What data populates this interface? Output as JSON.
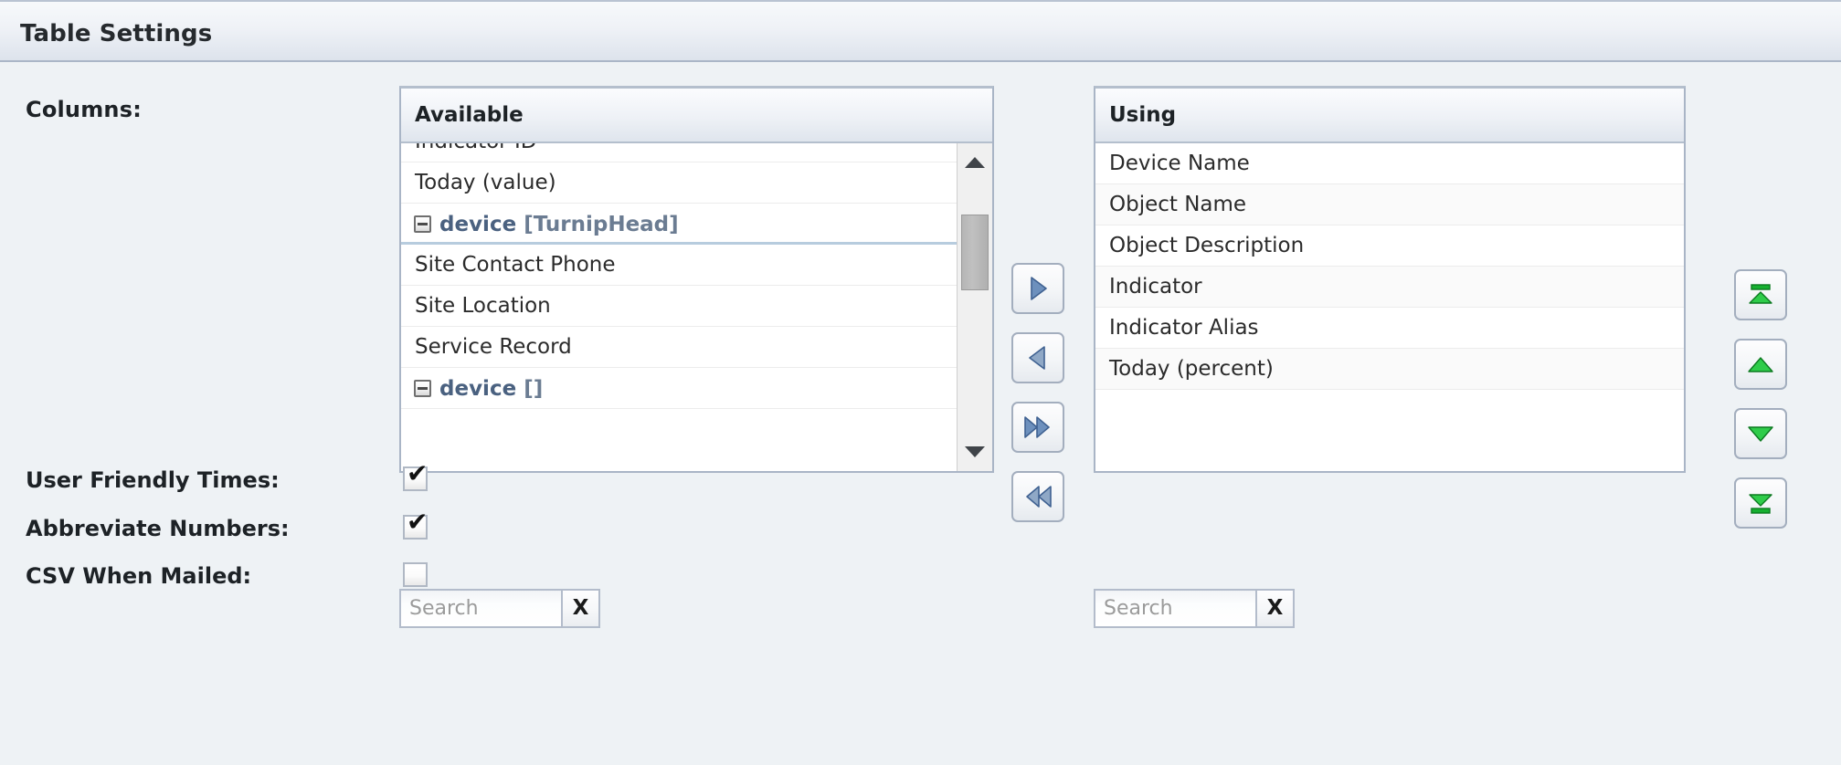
{
  "window": {
    "title": "Table Settings"
  },
  "form": {
    "columns_label": "Columns:"
  },
  "available": {
    "header": "Available",
    "rows": [
      {
        "label": "Indicator ID",
        "type": "item",
        "partial": true
      },
      {
        "label": "Today (value)",
        "type": "item"
      },
      {
        "label": "device [TurnipHead]",
        "type": "group",
        "name": "device",
        "bracket": "[TurnipHead]"
      },
      {
        "label": "Site Contact Phone",
        "type": "item"
      },
      {
        "label": "Site Location",
        "type": "item"
      },
      {
        "label": "Service Record",
        "type": "item"
      },
      {
        "label": "device []",
        "type": "group",
        "name": "device",
        "bracket": "[]"
      }
    ],
    "search": {
      "value": "",
      "placeholder": "Search",
      "clear_label": "X"
    },
    "scrollbar": {
      "up_icon": "triangle-up-icon",
      "down_icon": "triangle-down-icon"
    }
  },
  "using": {
    "header": "Using",
    "rows": [
      {
        "label": "Device Name"
      },
      {
        "label": "Object Name"
      },
      {
        "label": "Object Description"
      },
      {
        "label": "Indicator"
      },
      {
        "label": "Indicator Alias"
      },
      {
        "label": "Today (percent)"
      }
    ],
    "search": {
      "value": "",
      "placeholder": "Search",
      "clear_label": "X"
    }
  },
  "transfer_buttons": [
    {
      "icon": "arrow-right-icon",
      "title": "Add selected"
    },
    {
      "icon": "arrow-left-icon",
      "title": "Remove selected"
    },
    {
      "icon": "double-arrow-right-icon",
      "title": "Add all"
    },
    {
      "icon": "double-arrow-left-icon",
      "title": "Remove all"
    }
  ],
  "reorder_buttons": [
    {
      "icon": "move-to-top-icon",
      "title": "Move to top"
    },
    {
      "icon": "move-up-icon",
      "title": "Move up"
    },
    {
      "icon": "move-down-icon",
      "title": "Move down"
    },
    {
      "icon": "move-to-bottom-icon",
      "title": "Move to bottom"
    }
  ],
  "options": [
    {
      "label": "User Friendly Times:",
      "checked": true,
      "tick": "✔"
    },
    {
      "label": "Abbreviate Numbers:",
      "checked": true,
      "tick": "✔"
    },
    {
      "label": "CSV When Mailed:",
      "checked": false,
      "tick": ""
    }
  ],
  "colors": {
    "page_background": "#eef2f5",
    "panel_border": "#a9b5c6",
    "group_text": "#4a6180",
    "blue_arrow": "#5a7ca8",
    "green_arrow": "#16b030",
    "row_alt": "#fafafa",
    "scroll_thumb": "#b6b6b6"
  }
}
